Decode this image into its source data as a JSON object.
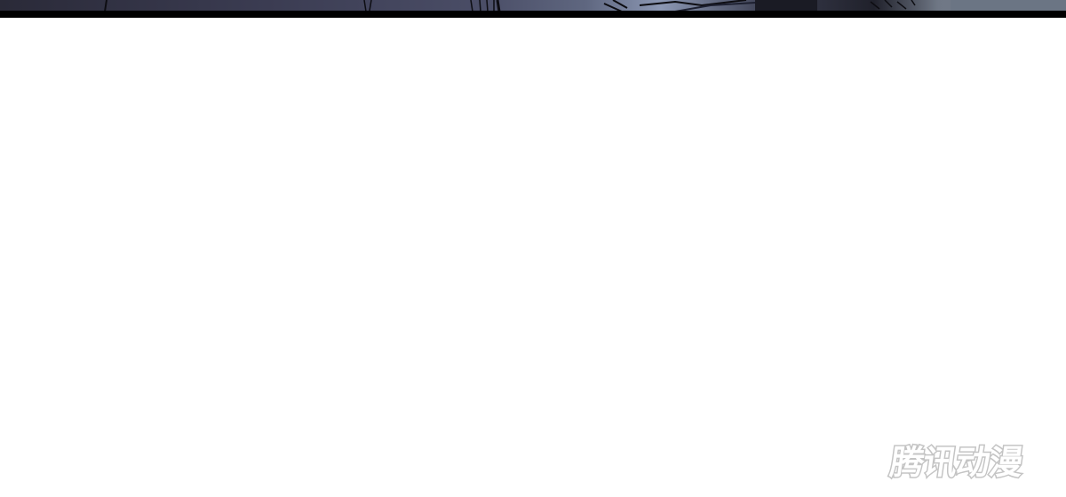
{
  "panel": {
    "description_colors": {
      "border": "#000000",
      "dark_tone": "#2c2c3f",
      "mid_tone": "#5a5f7a",
      "light_tone": "#a9b6c8",
      "background": "#ffffff"
    }
  },
  "watermark": {
    "text": "腾讯动漫",
    "color": "#ffffff",
    "outline": "#c9c9c9"
  }
}
